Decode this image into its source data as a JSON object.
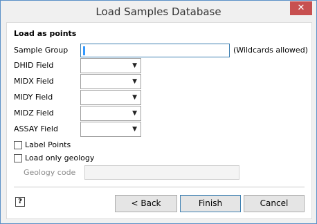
{
  "window": {
    "title": "Load Samples Database",
    "close_glyph": "✕"
  },
  "section": {
    "title": "Load as points"
  },
  "sample_group": {
    "label": "Sample Group",
    "value": "",
    "hint": "(Wildcards allowed)"
  },
  "fields": [
    {
      "label": "DHID  Field",
      "value": ""
    },
    {
      "label": "MIDX  Field",
      "value": ""
    },
    {
      "label": "MIDY  Field",
      "value": ""
    },
    {
      "label": "MIDZ  Field",
      "value": ""
    },
    {
      "label": "ASSAY Field",
      "value": ""
    }
  ],
  "checkboxes": {
    "label_points": {
      "label": "Label Points",
      "checked": false
    },
    "load_only_geology": {
      "label": "Load only geology",
      "checked": false
    }
  },
  "geology_code": {
    "label": "Geology code",
    "value": ""
  },
  "help": {
    "glyph": "?"
  },
  "buttons": {
    "back": "< Back",
    "finish": "Finish",
    "cancel": "Cancel"
  },
  "icons": {
    "dropdown": "chevron-down-icon",
    "help": "help-icon",
    "close": "close-icon"
  }
}
